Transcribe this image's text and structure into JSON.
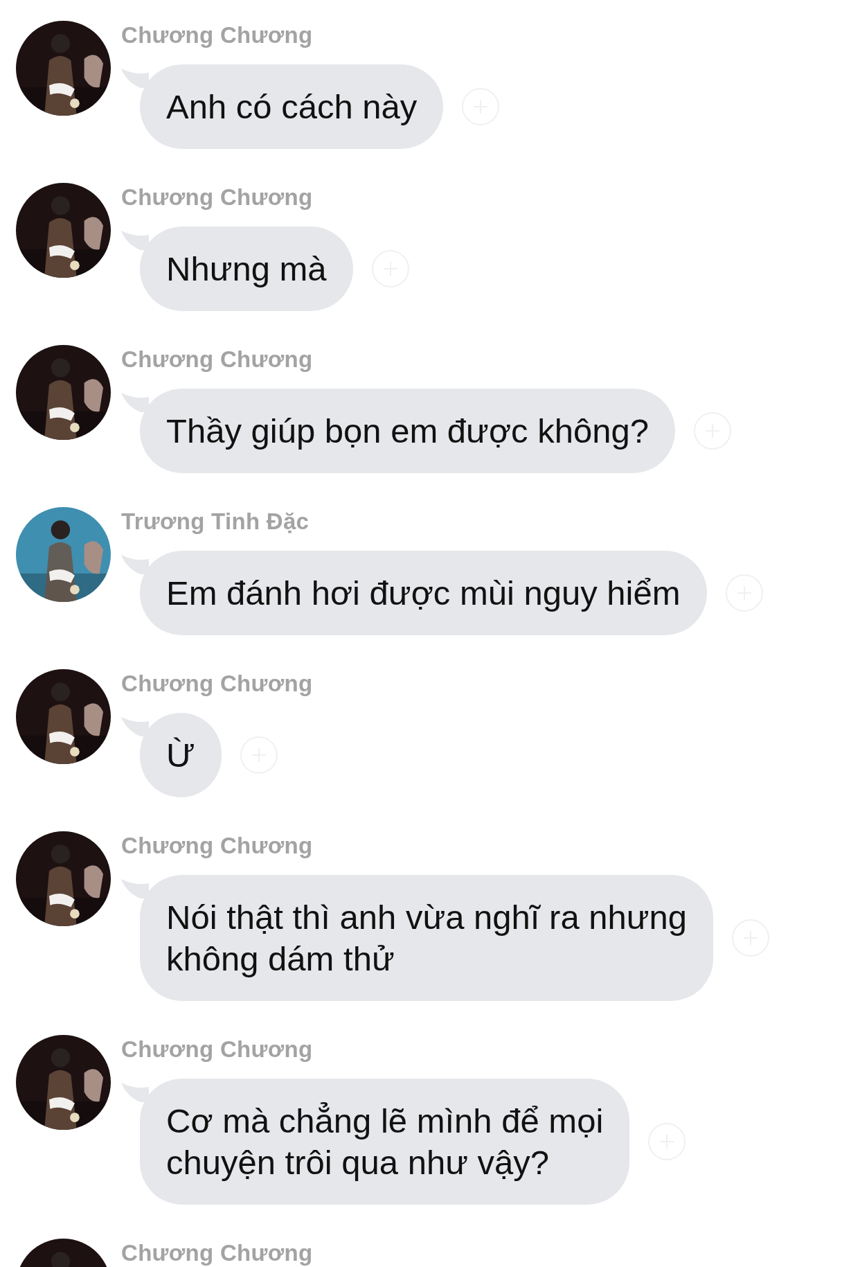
{
  "messages": [
    {
      "sender": "Chương Chương",
      "avatar": {
        "kind": "picture",
        "color": "#1d1112"
      },
      "lines": [
        "Anh có cách này"
      ]
    },
    {
      "sender": "Chương Chương",
      "avatar": {
        "kind": "picture",
        "color": "#1d1112"
      },
      "lines": [
        "Nhưng mà"
      ]
    },
    {
      "sender": "Chương Chương",
      "avatar": {
        "kind": "picture",
        "color": "#1d1112"
      },
      "lines": [
        "Thầy giúp bọn em được không?"
      ]
    },
    {
      "sender": "Trương Tinh Đặc",
      "avatar": {
        "kind": "picture",
        "color": "#3f8fb0"
      },
      "lines": [
        "Em đánh hơi được mùi nguy hiểm"
      ]
    },
    {
      "sender": "Chương Chương",
      "avatar": {
        "kind": "picture",
        "color": "#1d1112"
      },
      "lines": [
        "Ừ"
      ]
    },
    {
      "sender": "Chương Chương",
      "avatar": {
        "kind": "picture",
        "color": "#1d1112"
      },
      "lines": [
        "Nói thật thì anh vừa nghĩ ra nhưng",
        "không dám thử"
      ]
    },
    {
      "sender": "Chương Chương",
      "avatar": {
        "kind": "picture",
        "color": "#1d1112"
      },
      "lines": [
        "Cơ mà chẳng lẽ mình để mọi",
        "chuyện trôi qua như vậy?"
      ]
    },
    {
      "sender": "Chương Chương",
      "avatar": {
        "kind": "picture",
        "color": "#1d1112"
      }
    }
  ]
}
